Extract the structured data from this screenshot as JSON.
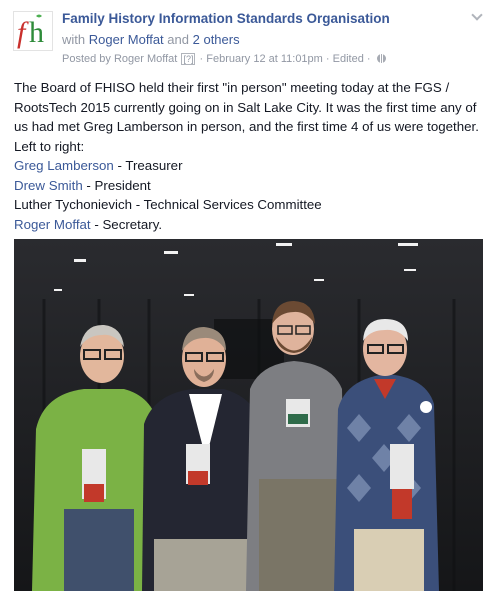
{
  "post": {
    "page_name": "Family History Information Standards Organisation",
    "with_prefix": "with",
    "with_person": "Roger Moffat",
    "with_and": "and",
    "with_others": "2 others",
    "posted_by": "Posted by Roger Moffat",
    "posted_by_q": "[?]",
    "timestamp": "February 12 at 11:01pm",
    "edited": "Edited",
    "dot": "·",
    "logo_text": "fh",
    "privacy_icon": "globe-icon",
    "menu_icon": "chevron-down-icon",
    "text_intro": "The Board of FHISO held their first \"in person\" meeting today at the FGS / RootsTech 2015 currently going on in Salt Lake City. It was the first time any of us had met Greg Lamberson in person, and the first time 4 of us were together. Left to right:",
    "roles": [
      {
        "name": "Greg Lamberson",
        "role": " - Treasurer",
        "linked": true
      },
      {
        "name": "Drew Smith",
        "role": " - President",
        "linked": true
      },
      {
        "name": "Luther Tychonievich",
        "role": " - Technical Services Committee",
        "linked": false
      },
      {
        "name": "Roger Moffat",
        "role": " - Secretary.",
        "linked": true
      }
    ]
  },
  "colors": {
    "link": "#3b5998",
    "meta": "#9197a3",
    "logo_f": "#c9302c",
    "logo_h": "#2e8b3a"
  }
}
